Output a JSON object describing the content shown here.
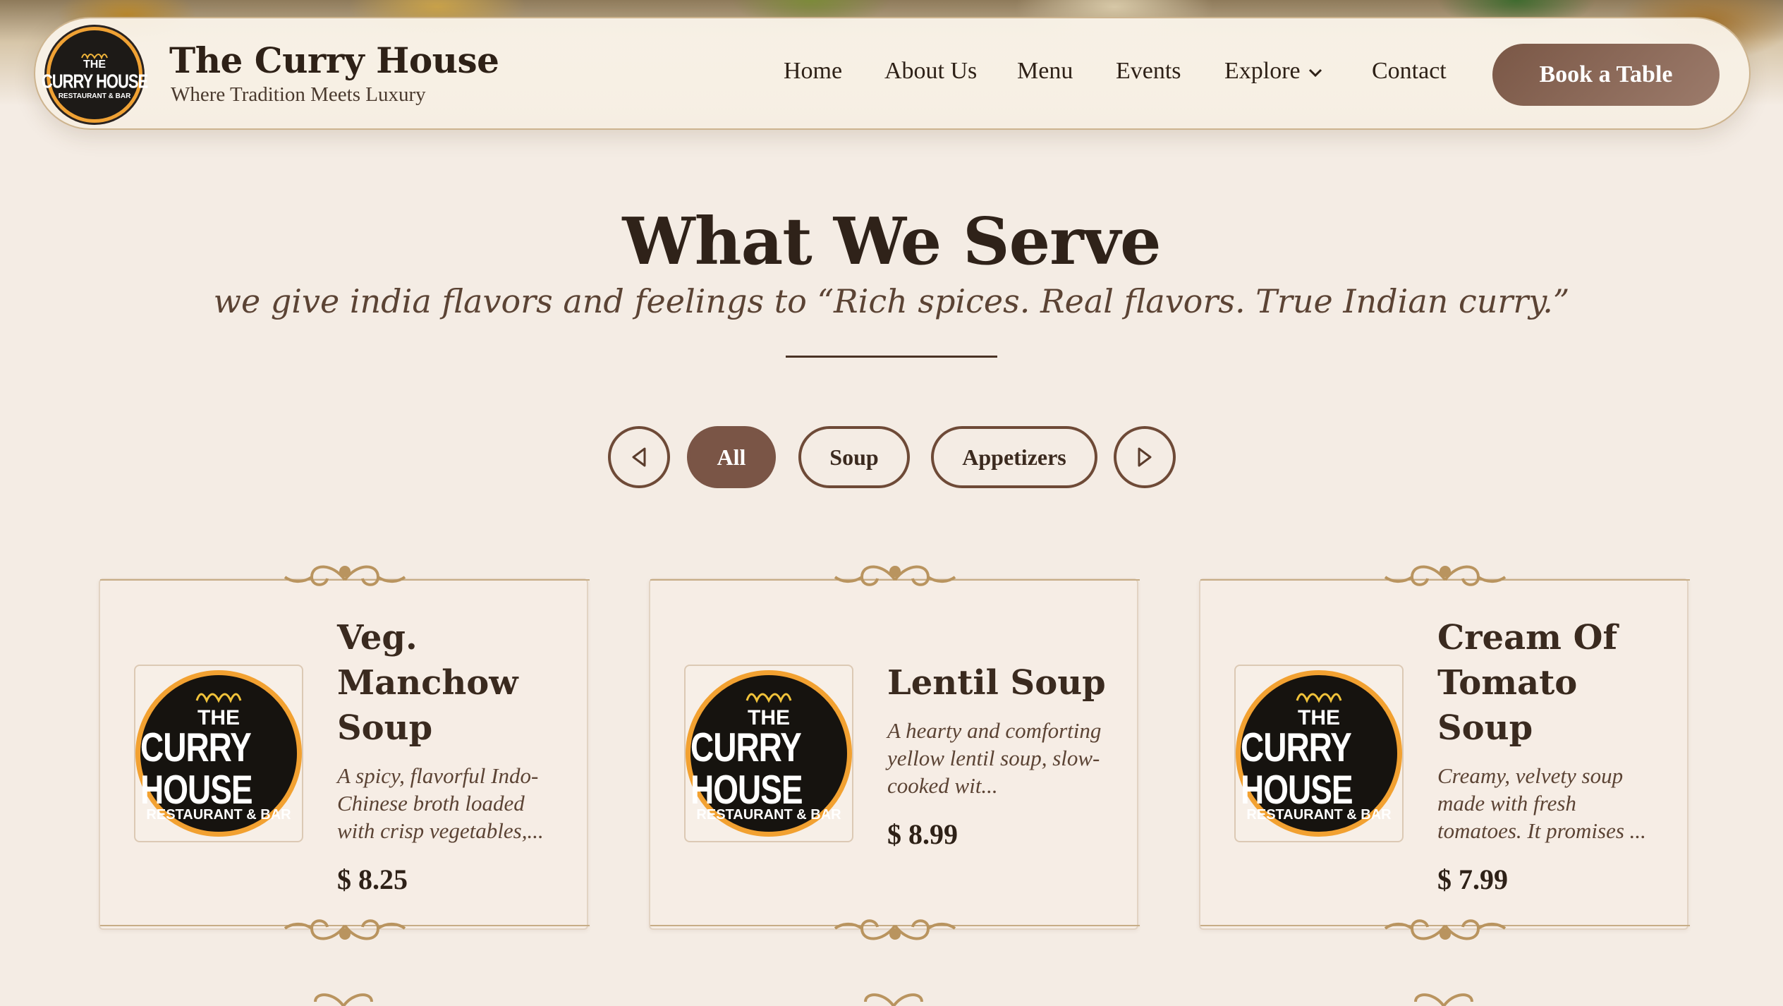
{
  "brand": {
    "title": "The Curry House",
    "tagline": "Where Tradition Meets Luxury",
    "logo_top": "THE",
    "logo_main": "CURRY HOUSE",
    "logo_ring": "RESTAURANT & BAR"
  },
  "nav": {
    "items": [
      "Home",
      "About Us",
      "Menu",
      "Events",
      "Explore",
      "Contact"
    ],
    "cta": "Book a Table"
  },
  "section": {
    "title": "What We Serve",
    "subtitle": "we give india flavors and feelings to “Rich spices. Real flavors. True Indian curry.”"
  },
  "filters": {
    "prev_icon": "chevron-left-icon",
    "next_icon": "chevron-right-icon",
    "tabs": [
      "All",
      "Soup",
      "Appetizers"
    ],
    "active": "All"
  },
  "cards": [
    {
      "name": "Veg. Manchow Soup",
      "description": "A spicy, flavorful Indo-Chinese broth loaded with crisp vegetables,...",
      "price": "$ 8.25"
    },
    {
      "name": "Lentil Soup",
      "description": "A hearty and comforting yellow lentil soup, slow-cooked wit...",
      "price": "$ 8.99"
    },
    {
      "name": "Cream Of Tomato Soup",
      "description": "Creamy, velvety soup made with fresh tomatoes. It promises ...",
      "price": "$ 7.99"
    }
  ],
  "colors": {
    "background": "#f4ece4",
    "accent": "#7a5546",
    "text": "#2e2117",
    "logo_ring": "#f2a131"
  }
}
